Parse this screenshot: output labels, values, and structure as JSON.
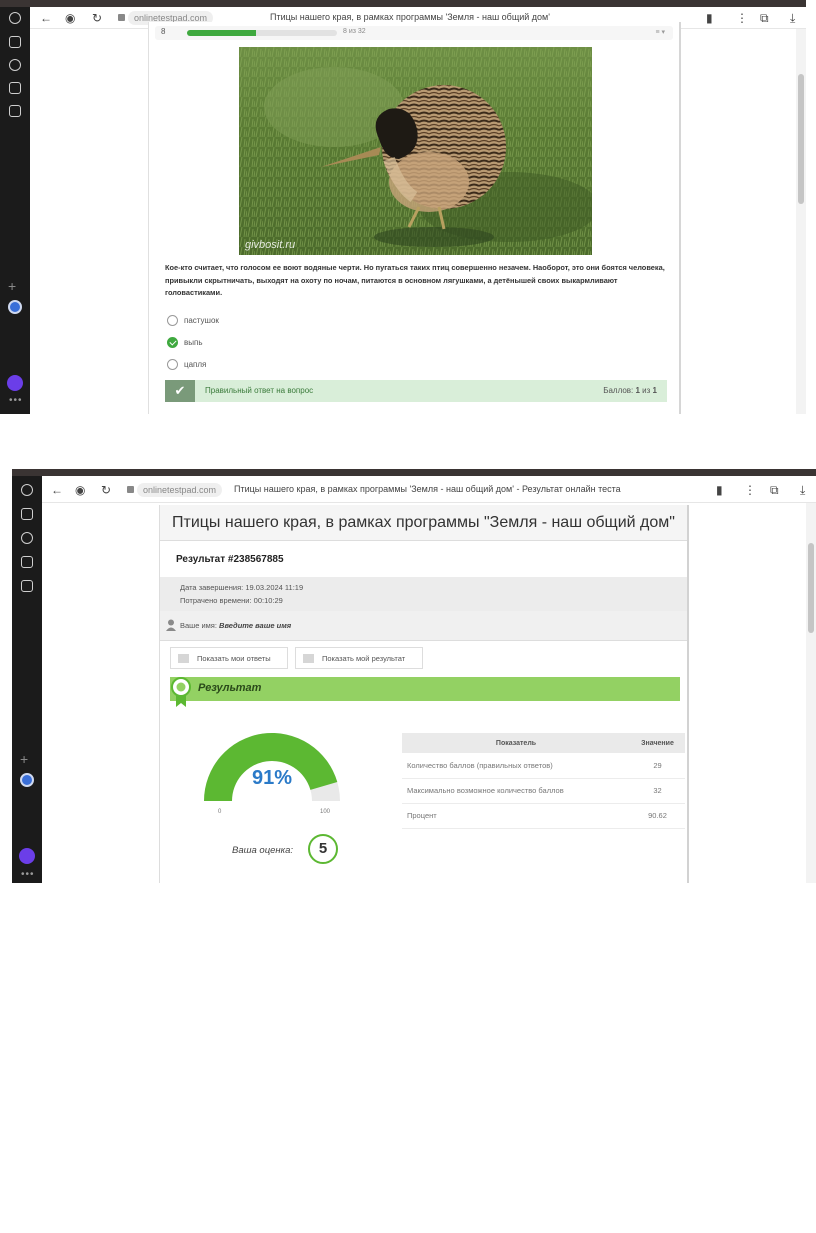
{
  "screen1": {
    "browser": {
      "domain": "onlinetestpad.com",
      "tab_title": "Птицы нашего края, в рамках программы 'Земля - наш общий дом'"
    },
    "progress": {
      "question_number": "8",
      "counter": "8 из 32",
      "fraction": 0.46
    },
    "photo": {
      "watermark": "givbosit.ru"
    },
    "question_text": "Кое-кто считает, что голосом ее воют водяные черти. Но пугаться таких птиц совершенно незачем. Наоборот, это они боятся человека, привыкли скрытничать, выходят на охоту по ночам, питаются в основном лягушками, а детёнышей своих выкармливают головастиками.",
    "options": [
      {
        "label": "пастушок",
        "selected": false
      },
      {
        "label": "выпь",
        "selected": true
      },
      {
        "label": "цапля",
        "selected": false
      }
    ],
    "answer_bar": {
      "text": "Правильный ответ на вопрос",
      "score_prefix": "Баллов:",
      "score_value": "1",
      "score_mid": "из",
      "score_max": "1"
    }
  },
  "screen2": {
    "browser": {
      "domain": "onlinetestpad.com",
      "tab_title": "Птицы нашего края, в рамках программы 'Земля - наш общий дом' - Результат онлайн теста"
    },
    "test_title": "Птицы нашего края, в рамках программы \"Земля - наш общий дом\"",
    "result_number": "Результат #238567885",
    "completed_label": "Дата завершения:",
    "completed_value": "19.03.2024 11:19",
    "time_label": "Потрачено времени:",
    "time_value": "00:10:29",
    "user_label": "Ваше имя:",
    "user_placeholder": "Введите ваше имя",
    "buttons": {
      "show_answers": "Показать мои ответы",
      "show_result": "Показать мой результат"
    },
    "result_header": "Результат",
    "gauge": {
      "value": "91%",
      "percent": 91,
      "min": "0",
      "max": "100"
    },
    "grade_label": "Ваша оценка:",
    "grade_value": "5",
    "table": {
      "headers": [
        "Показатель",
        "Значение"
      ],
      "rows": [
        {
          "label": "Количество баллов (правильных ответов)",
          "value": "29"
        },
        {
          "label": "Максимально возможное количество баллов",
          "value": "32"
        },
        {
          "label": "Процент",
          "value": "90.62"
        }
      ]
    }
  },
  "colors": {
    "accent_green": "#3fa93f",
    "result_green": "#93d163",
    "gauge_green": "#5cb832",
    "percent_blue": "#2a7ac8"
  }
}
